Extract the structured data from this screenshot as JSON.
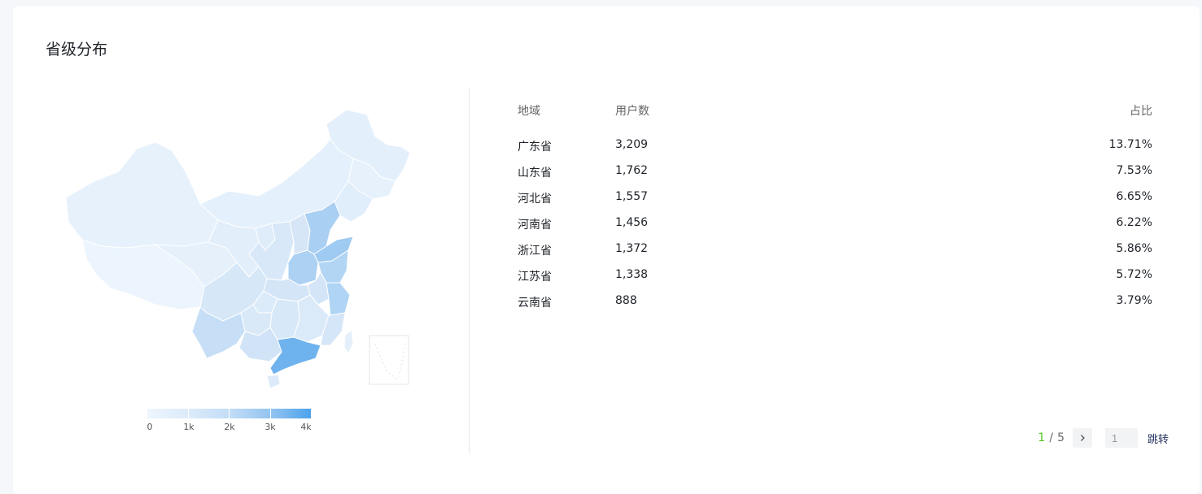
{
  "card": {
    "title": "省级分布"
  },
  "colors": {
    "scale_low": "#eaf4fd",
    "scale_high": "#4da3ec",
    "page_current": "#52c41a"
  },
  "legend": {
    "ticks": [
      "0",
      "1k",
      "2k",
      "3k",
      "4k"
    ],
    "min": 0,
    "max": 4000
  },
  "table": {
    "headers": {
      "region": "地域",
      "users": "用户数",
      "share": "占比"
    },
    "rows": [
      {
        "region": "广东省",
        "users": "3,209",
        "share": "13.71%"
      },
      {
        "region": "山东省",
        "users": "1,762",
        "share": "7.53%"
      },
      {
        "region": "河北省",
        "users": "1,557",
        "share": "6.65%"
      },
      {
        "region": "河南省",
        "users": "1,456",
        "share": "6.22%"
      },
      {
        "region": "浙江省",
        "users": "1,372",
        "share": "5.86%"
      },
      {
        "region": "江苏省",
        "users": "1,338",
        "share": "5.72%"
      },
      {
        "region": "云南省",
        "users": "888",
        "share": "3.79%"
      }
    ]
  },
  "pagination": {
    "current": "1",
    "separator": "/",
    "total": "5",
    "next_icon": "chevron-right-icon",
    "jump_value": "1",
    "jump_label": "跳转"
  }
}
